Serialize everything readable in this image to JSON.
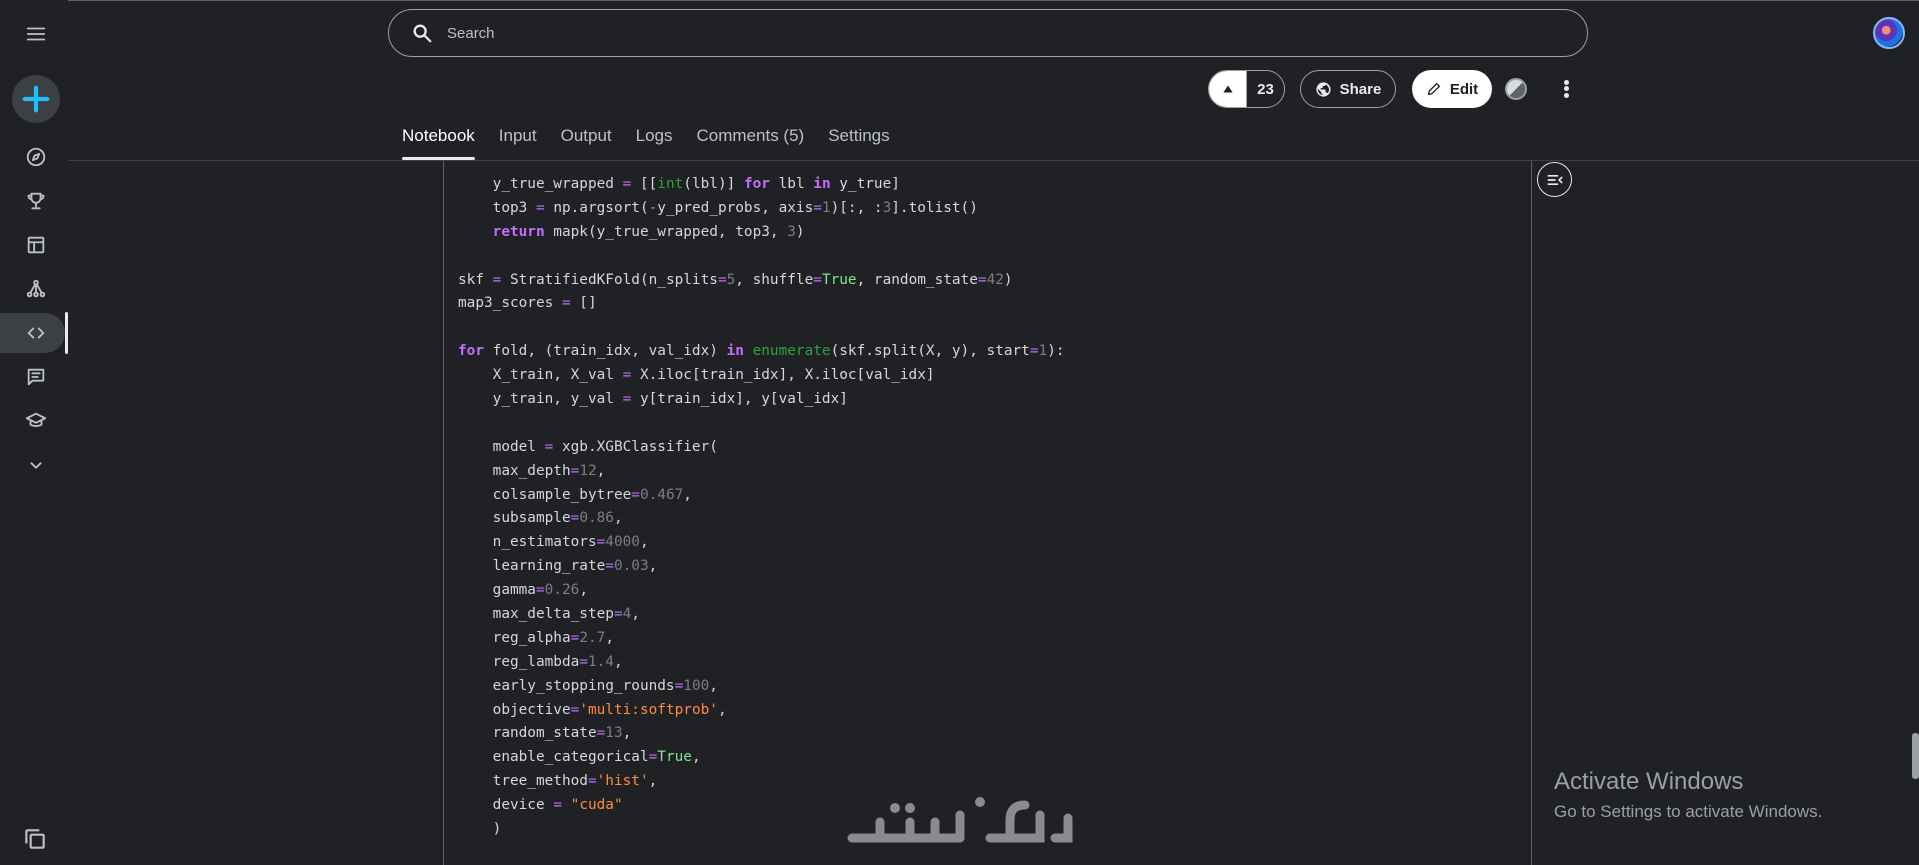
{
  "search": {
    "placeholder": "Search"
  },
  "header": {
    "vote_count": "23",
    "share_label": "Share",
    "edit_label": "Edit"
  },
  "tabs": [
    {
      "label": "Notebook",
      "active": true
    },
    {
      "label": "Input"
    },
    {
      "label": "Output"
    },
    {
      "label": "Logs"
    },
    {
      "label": "Comments (5)"
    },
    {
      "label": "Settings"
    }
  ],
  "sidebar": {
    "icons": [
      "menu-icon",
      "create-icon",
      "compass-icon",
      "trophy-icon",
      "table-icon",
      "models-icon",
      "code-icon",
      "discussion-icon",
      "learn-icon",
      "chevron-down-icon",
      "copy-icon"
    ]
  },
  "code_lines": [
    "    y_true_wrapped = [[int(lbl)] for lbl in y_true]",
    "    top3 = np.argsort(-y_pred_probs, axis=1)[:, :3].tolist()",
    "    return mapk(y_true_wrapped, top3, 3)",
    "",
    "skf = StratifiedKFold(n_splits=5, shuffle=True, random_state=42)",
    "map3_scores = []",
    "",
    "for fold, (train_idx, val_idx) in enumerate(skf.split(X, y), start=1):",
    "    X_train, X_val = X.iloc[train_idx], X.iloc[val_idx]",
    "    y_train, y_val = y[train_idx], y[val_idx]",
    "",
    "    model = xgb.XGBClassifier(",
    "    max_depth=12,",
    "    colsample_bytree=0.467,",
    "    subsample=0.86,",
    "    n_estimators=4000,",
    "    learning_rate=0.03,",
    "    gamma=0.26,",
    "    max_delta_step=4,",
    "    reg_alpha=2.7,",
    "    reg_lambda=1.4,",
    "    early_stopping_rounds=100,",
    "    objective='multi:softprob',",
    "    random_state=13,",
    "    enable_categorical=True,",
    "    tree_method='hist',",
    "    device = \"cuda\"",
    "    )"
  ],
  "windows_notice": {
    "title": "Activate Windows",
    "subtitle": "Go to Settings to activate Windows."
  },
  "colors": {
    "background": "#202124",
    "accent": "#20beff",
    "keyword": "#c46eff",
    "string": "#ff8a3d",
    "number": "#7e7e7e"
  }
}
